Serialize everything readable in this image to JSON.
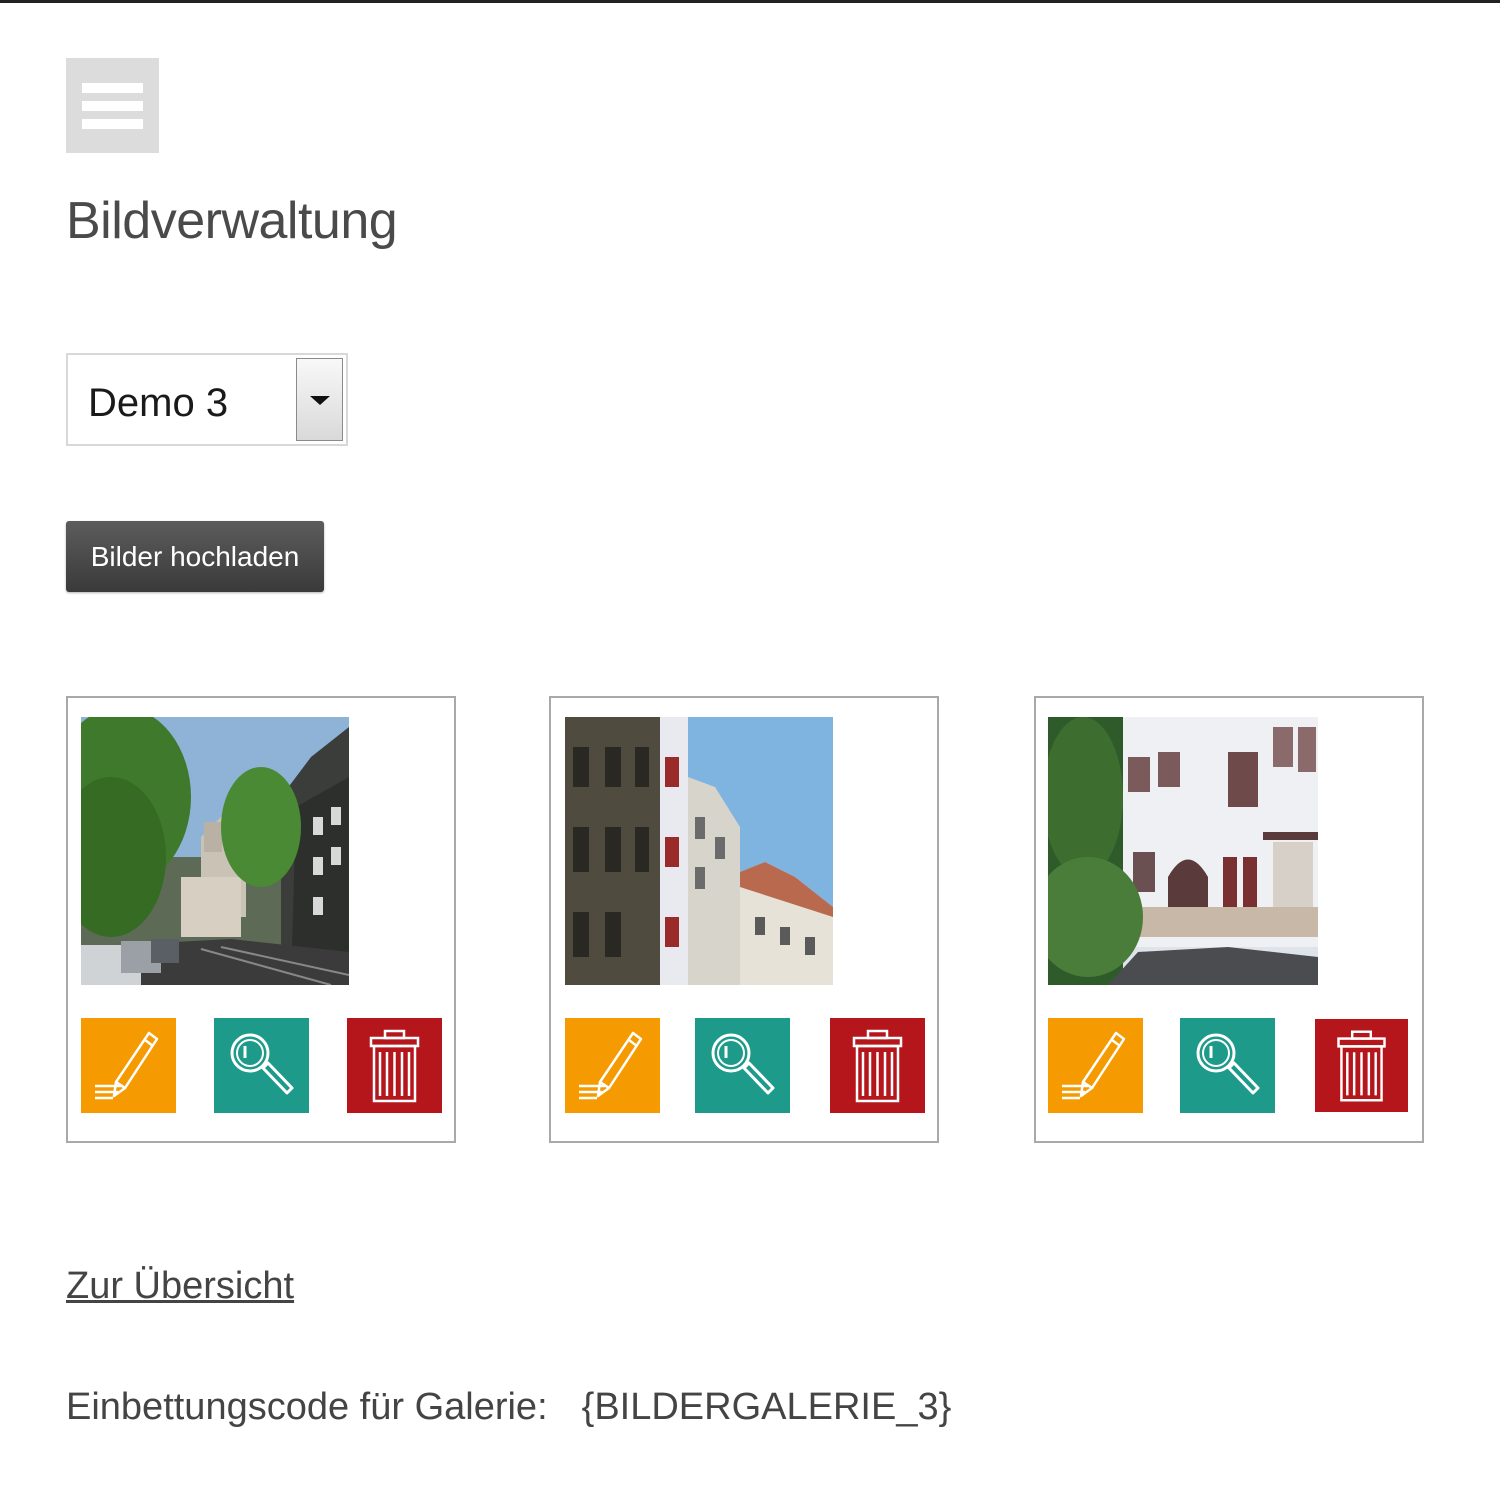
{
  "page": {
    "title": "Bildverwaltung",
    "menu_icon": "hamburger-menu-icon"
  },
  "gallery_select": {
    "selected": "Demo 3",
    "arrow_icon": "chevron-down-icon"
  },
  "upload": {
    "label": "Bilder hochladen"
  },
  "images": [
    {
      "scene": "street-trees-church"
    },
    {
      "scene": "street-facades-sky"
    },
    {
      "scene": "street-white-house"
    }
  ],
  "actions": {
    "edit": {
      "icon": "pencil-icon",
      "color": "#f59a00"
    },
    "view": {
      "icon": "magnifier-icon",
      "color": "#1e9a8a"
    },
    "delete": {
      "icon": "trash-icon",
      "color": "#b5161b"
    }
  },
  "footer": {
    "overview_link": "Zur Übersicht",
    "embed_label": "Einbettungscode für Galerie:",
    "embed_code": "{BILDERGALERIE_3}"
  }
}
